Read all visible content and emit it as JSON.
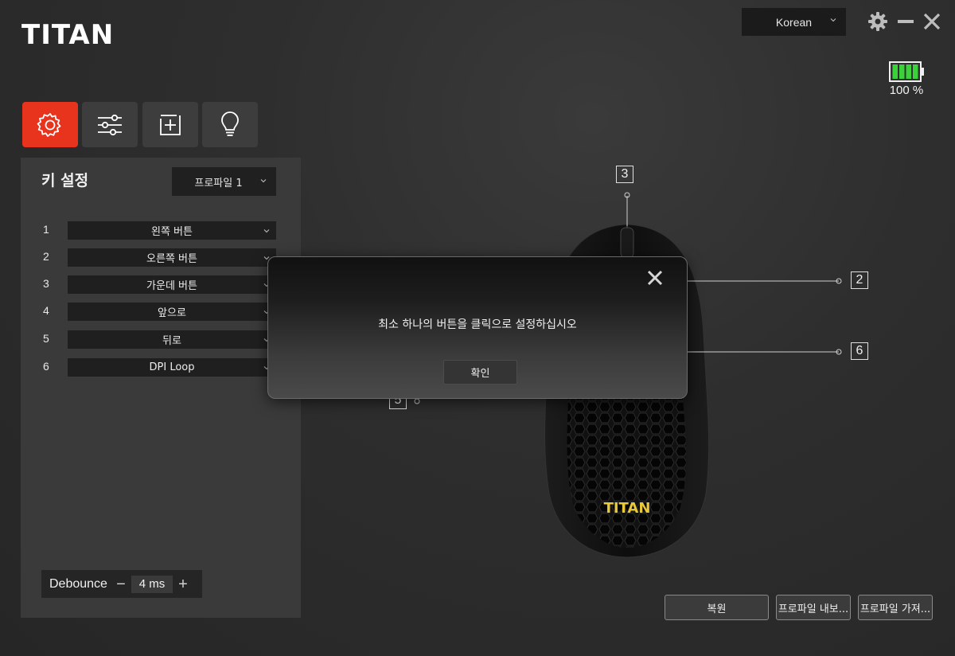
{
  "app": {
    "brand": "TITAN"
  },
  "header": {
    "language": "Korean",
    "battery_label": "100 %",
    "battery_level": 1.0
  },
  "tabs": [
    {
      "icon": "gear-icon",
      "active": true
    },
    {
      "icon": "sliders-icon",
      "active": false
    },
    {
      "icon": "macro-plus-icon",
      "active": false
    },
    {
      "icon": "lightbulb-icon",
      "active": false
    }
  ],
  "key_settings": {
    "title": "키 설정",
    "profile": "프로파일 1",
    "rows": [
      {
        "num": "1",
        "value": "왼쪽 버튼"
      },
      {
        "num": "2",
        "value": "오른쪽 버튼"
      },
      {
        "num": "3",
        "value": "가운데 버튼"
      },
      {
        "num": "4",
        "value": "앞으로"
      },
      {
        "num": "5",
        "value": "뒤로"
      },
      {
        "num": "6",
        "value": "DPI Loop"
      }
    ],
    "debounce": {
      "label": "Debounce",
      "value": "4 ms",
      "minus": "−",
      "plus": "+"
    }
  },
  "mouse_callouts": [
    "3",
    "2",
    "6",
    "5"
  ],
  "dialog": {
    "message": "최소 하나의 버튼을 클릭으로 설정하십시오",
    "ok_label": "확인"
  },
  "bottom_buttons": {
    "restore": "복원",
    "export": "프로파일 내보...",
    "import": "프로파일 가져..."
  },
  "colors": {
    "accent": "#e8331d",
    "battery": "#3ad13a"
  }
}
